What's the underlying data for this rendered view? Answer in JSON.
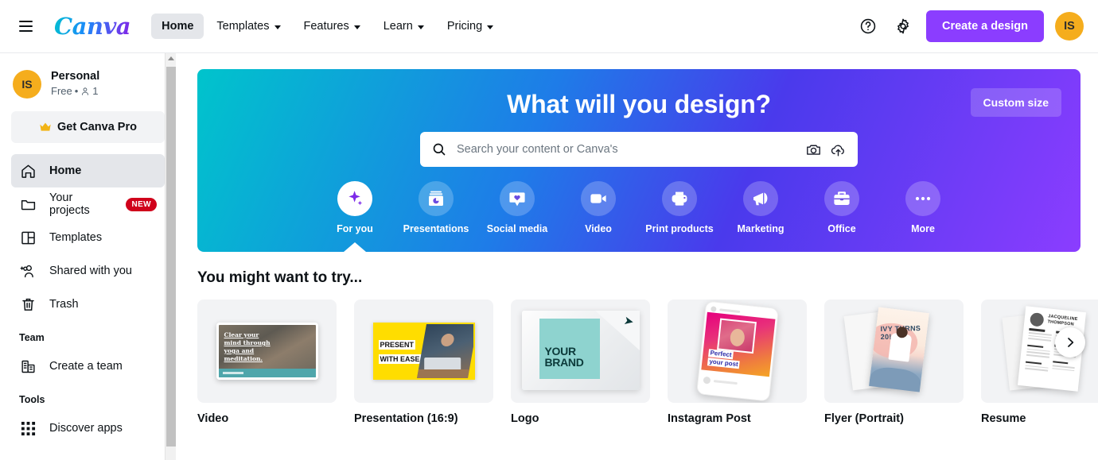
{
  "header": {
    "menu_icon": "hamburger-icon",
    "logo_text": "Canva",
    "nav": [
      {
        "label": "Home",
        "active": true,
        "caret": false
      },
      {
        "label": "Templates",
        "active": false,
        "caret": true
      },
      {
        "label": "Features",
        "active": false,
        "caret": true
      },
      {
        "label": "Learn",
        "active": false,
        "caret": true
      },
      {
        "label": "Pricing",
        "active": false,
        "caret": true
      }
    ],
    "help_icon": "question-circle-icon",
    "settings_icon": "gear-icon",
    "create_button": "Create a design",
    "avatar_initials": "IS"
  },
  "sidebar": {
    "profile": {
      "avatar_initials": "IS",
      "name": "Personal",
      "plan": "Free",
      "separator": "•",
      "member_count": "1",
      "member_icon": "person-icon"
    },
    "pro_button": {
      "label": "Get Canva Pro",
      "icon": "crown-icon"
    },
    "items": [
      {
        "label": "Home",
        "icon": "home-icon",
        "active": true,
        "badge": ""
      },
      {
        "label": "Your projects",
        "icon": "folder-icon",
        "active": false,
        "badge": "NEW"
      },
      {
        "label": "Templates",
        "icon": "templates-icon",
        "active": false,
        "badge": ""
      },
      {
        "label": "Shared with you",
        "icon": "people-add-icon",
        "active": false,
        "badge": ""
      },
      {
        "label": "Trash",
        "icon": "trash-icon",
        "active": false,
        "badge": ""
      }
    ],
    "team_section_label": "Team",
    "team_items": [
      {
        "label": "Create a team",
        "icon": "building-icon"
      }
    ],
    "tools_section_label": "Tools",
    "tools_items": [
      {
        "label": "Discover apps",
        "icon": "grid-apps-icon"
      }
    ]
  },
  "banner": {
    "title": "What will you design?",
    "custom_size_button": "Custom size",
    "search": {
      "placeholder": "Search your content or Canva's",
      "value": "",
      "search_icon": "search-icon",
      "camera_icon": "camera-icon",
      "upload_icon": "cloud-upload-icon"
    },
    "categories": [
      {
        "label": "For you",
        "icon": "sparkle-icon",
        "active": true
      },
      {
        "label": "Presentations",
        "icon": "presentation-icon",
        "active": false
      },
      {
        "label": "Social media",
        "icon": "heart-bubble-icon",
        "active": false
      },
      {
        "label": "Video",
        "icon": "video-camera-icon",
        "active": false
      },
      {
        "label": "Print products",
        "icon": "printer-icon",
        "active": false
      },
      {
        "label": "Marketing",
        "icon": "megaphone-icon",
        "active": false
      },
      {
        "label": "Office",
        "icon": "briefcase-icon",
        "active": false
      },
      {
        "label": "More",
        "icon": "ellipsis-icon",
        "active": false
      }
    ],
    "colors": {
      "gradient_start": "#00c4cc",
      "gradient_mid": "#1e7ce8",
      "gradient_end": "#8b3dff"
    }
  },
  "suggestions": {
    "heading": "You might want to try...",
    "cards": [
      {
        "label": "Video",
        "art": "video"
      },
      {
        "label": "Presentation (16:9)",
        "art": "presentation",
        "text_line1": "PRESENT",
        "text_line2": "WITH EASE"
      },
      {
        "label": "Logo",
        "art": "logo",
        "text_line1": "YOUR",
        "text_line2": "BRAND"
      },
      {
        "label": "Instagram Post",
        "art": "instagram",
        "text_line1": "Perfect",
        "text_line2": "your post"
      },
      {
        "label": "Flyer (Portrait)",
        "art": "flyer",
        "text_line1": "IVY TURNS 20!"
      },
      {
        "label": "Resume",
        "art": "resume",
        "text_line1": "JACQUELINE",
        "text_line2": "THOMPSON"
      }
    ],
    "next_button_icon": "chevron-right-icon"
  },
  "video_card_art": {
    "caption": "Clear your mind through yoga and meditation."
  },
  "colors": {
    "brand_purple": "#8b3dff",
    "avatar_yellow": "#f5ad1d",
    "badge_red": "#d0021b",
    "active_grey": "#e4e6ea"
  }
}
